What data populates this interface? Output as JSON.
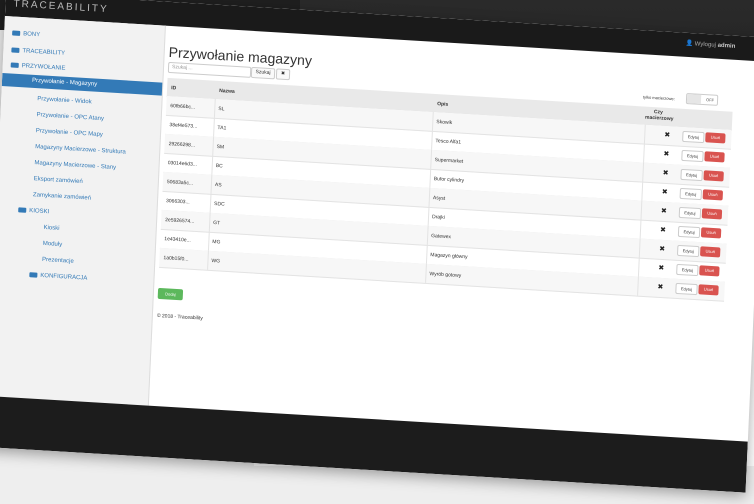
{
  "app": {
    "brand": "TRACEABILITY",
    "user_label": "Wyloguj",
    "user_name": "admin"
  },
  "sidebar": {
    "groups": [
      {
        "label": "BONY"
      },
      {
        "label": "TRACEABILITY"
      },
      {
        "label": "PRZYWOŁANIE"
      }
    ],
    "items": [
      {
        "label": "Przywołanie - Magazyny",
        "active": true
      },
      {
        "label": "Przywołanie - Widok"
      },
      {
        "label": "Przywołanie - OPC Atany"
      },
      {
        "label": "Przywołanie - OPC Mapy"
      },
      {
        "label": "Magazyny Macierzowe - Struktura"
      },
      {
        "label": "Magazyny Macierzowe - Stany"
      },
      {
        "label": "Eksport zamówień"
      },
      {
        "label": "Zamykanie zamówień"
      }
    ],
    "group_kiosk": "KIOSKI",
    "kiosk_items": [
      {
        "label": "Kioski"
      },
      {
        "label": "Moduły"
      },
      {
        "label": "Prezentacje"
      }
    ],
    "group_config": "KONFIGURACJA"
  },
  "main": {
    "title": "Przywołanie magazyny",
    "search_placeholder": "Szukaj ...",
    "search_button": "Szukaj",
    "clear_button": "✖",
    "filter_label": "tylko macierzowe:",
    "toggle_state": "OFF",
    "columns": {
      "id": "ID",
      "name": "Nazwa",
      "desc": "Opis",
      "matrix": "Czy macierzowy",
      "edit": "",
      "delete": ""
    },
    "rows": [
      {
        "id": "60fb66bc...",
        "name": "SL",
        "desc": "Skowik",
        "matrix": "✖",
        "edit": "Edytuj",
        "delete": "Usuń"
      },
      {
        "id": "38ef4e573...",
        "name": "TA1",
        "desc": "Tesco Alfa1",
        "matrix": "✖",
        "edit": "Edytuj",
        "delete": "Usuń"
      },
      {
        "id": "29266298...",
        "name": "SM",
        "desc": "Supermarket",
        "matrix": "✖",
        "edit": "Edytuj",
        "delete": "Usuń"
      },
      {
        "id": "03014e6d3...",
        "name": "BC",
        "desc": "Bufor cylindry",
        "matrix": "✖",
        "edit": "Edytuj",
        "delete": "Usuń"
      },
      {
        "id": "50683a5c...",
        "name": "AS",
        "desc": "Asyst",
        "matrix": "✖",
        "edit": "Edytuj",
        "delete": "Usuń"
      },
      {
        "id": "3066303...",
        "name": "SDC",
        "desc": "Drajki",
        "matrix": "✖",
        "edit": "Edytuj",
        "delete": "Usuń"
      },
      {
        "id": "2e5926574...",
        "name": "GT",
        "desc": "Gatewex",
        "matrix": "✖",
        "edit": "Edytuj",
        "delete": "Usuń"
      },
      {
        "id": "1e43410e...",
        "name": "MG",
        "desc": "Magazyn główny",
        "matrix": "✖",
        "edit": "Edytuj",
        "delete": "Usuń"
      },
      {
        "id": "1a0b15f0...",
        "name": "WG",
        "desc": "Wyrób gotowy",
        "matrix": "✖",
        "edit": "Edytuj",
        "delete": "Usuń"
      }
    ],
    "add_button": "Dodaj",
    "footer": "© 2018 - Traceability"
  },
  "colors": {
    "primary": "#337ab7",
    "danger": "#d9534f",
    "success": "#5cb85c",
    "topbar": "#1a1a1a"
  }
}
